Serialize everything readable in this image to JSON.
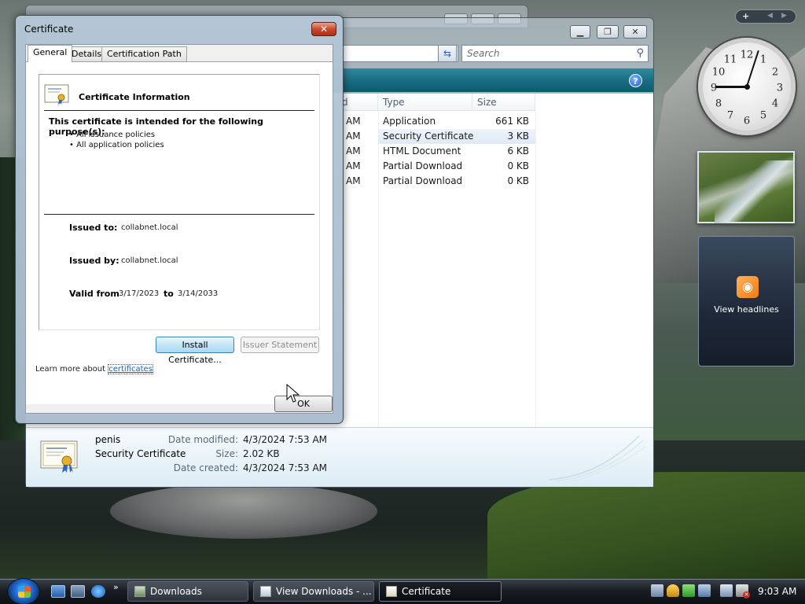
{
  "explorer": {
    "search_placeholder": "Search",
    "column_d": "d",
    "columns": {
      "type": "Type",
      "size": "Size"
    },
    "rows": [
      {
        "time": "AM",
        "type": "Application",
        "size": "661 KB"
      },
      {
        "time": "AM",
        "type": "Security Certificate",
        "size": "3 KB"
      },
      {
        "time": "AM",
        "type": "HTML Document",
        "size": "6 KB"
      },
      {
        "time": "AM",
        "type": "Partial Download",
        "size": "0 KB"
      },
      {
        "time": "AM",
        "type": "Partial Download",
        "size": "0 KB"
      }
    ],
    "details": {
      "name": "penis",
      "type": "Security Certificate",
      "modified_label": "Date modified:",
      "modified": "4/3/2024 7:53 AM",
      "size_label": "Size:",
      "size": "2.02 KB",
      "created_label": "Date created:",
      "created": "4/3/2024 7:53 AM"
    }
  },
  "cert": {
    "title": "Certificate",
    "close_glyph": "✕",
    "tabs": [
      "General",
      "Details",
      "Certification Path"
    ],
    "info_title": "Certificate Information",
    "purpose_heading": "This certificate is intended for the following purpose(s):",
    "purposes": [
      "• All issuance policies",
      "• All application policies"
    ],
    "issued_to_label": "Issued to:",
    "issued_to": "collabnet.local",
    "issued_by_label": "Issued by:",
    "issued_by": "collabnet.local",
    "valid_from_label": "Valid from",
    "valid_from": "3/17/2023",
    "valid_to_label": "to",
    "valid_to": "3/14/2033",
    "install_button": "Install Certificate...",
    "issuer_button": "Issuer Statement",
    "learn_more": "Learn more about",
    "learn_link": "certificates",
    "ok_button": "OK"
  },
  "gadgets": {
    "clock_numbers": [
      "12",
      "1",
      "2",
      "3",
      "4",
      "5",
      "6",
      "7",
      "8",
      "9",
      "10",
      "11"
    ],
    "feed_text": "View headlines",
    "control_plus": "+"
  },
  "taskbar": {
    "tasks": [
      "Downloads",
      "View Downloads - ...",
      "Certificate"
    ],
    "time": "9:03 AM",
    "ql_more": "»"
  }
}
